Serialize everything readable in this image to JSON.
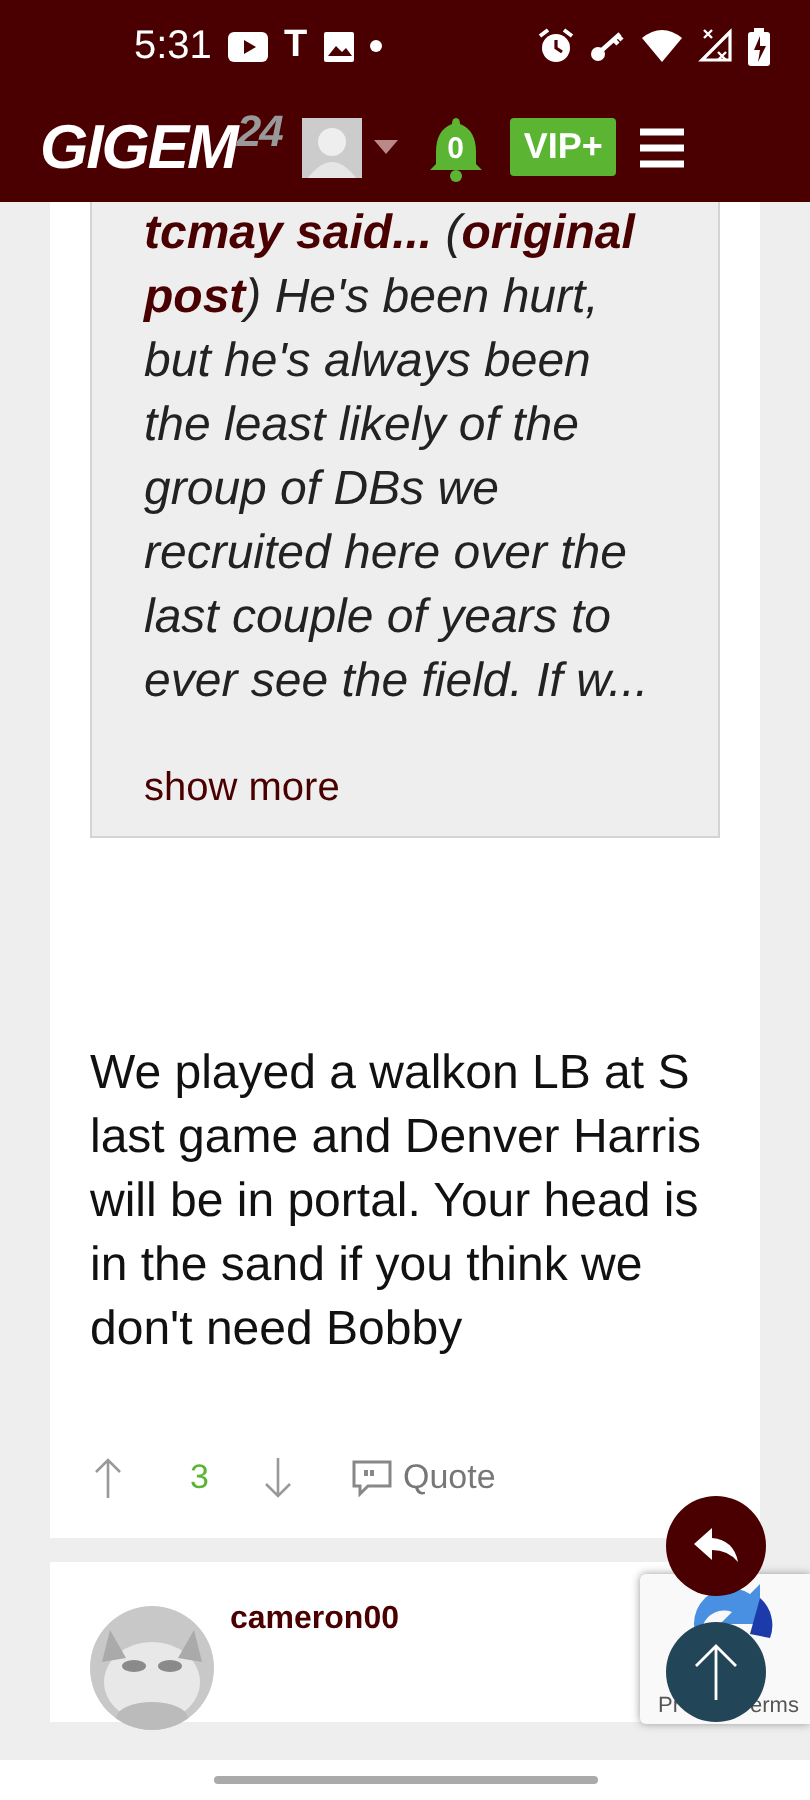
{
  "status_bar": {
    "time": "5:31",
    "app_letter": "T"
  },
  "header": {
    "logo": {
      "name": "GIGEM",
      "suffix": "24"
    },
    "notifications": "0",
    "vip_button": "VIP+"
  },
  "post": {
    "quote": {
      "text": "**tcmay said...** (**original post**) He's been hurt, but he's always been the least likely of the group of DBs we recruited here over the last couple of years to ever see the field. If w...",
      "show_more": "show more"
    },
    "body": "We played a walkon LB at S last game and Denver Harris will be in portal. Your head is in the sand if you think we don't need Bobby",
    "votes": "3",
    "quote_button": "Quote"
  },
  "next_post": {
    "username": "cameron00"
  },
  "recaptcha": {
    "texts": [
      "Pr",
      "erms"
    ]
  }
}
